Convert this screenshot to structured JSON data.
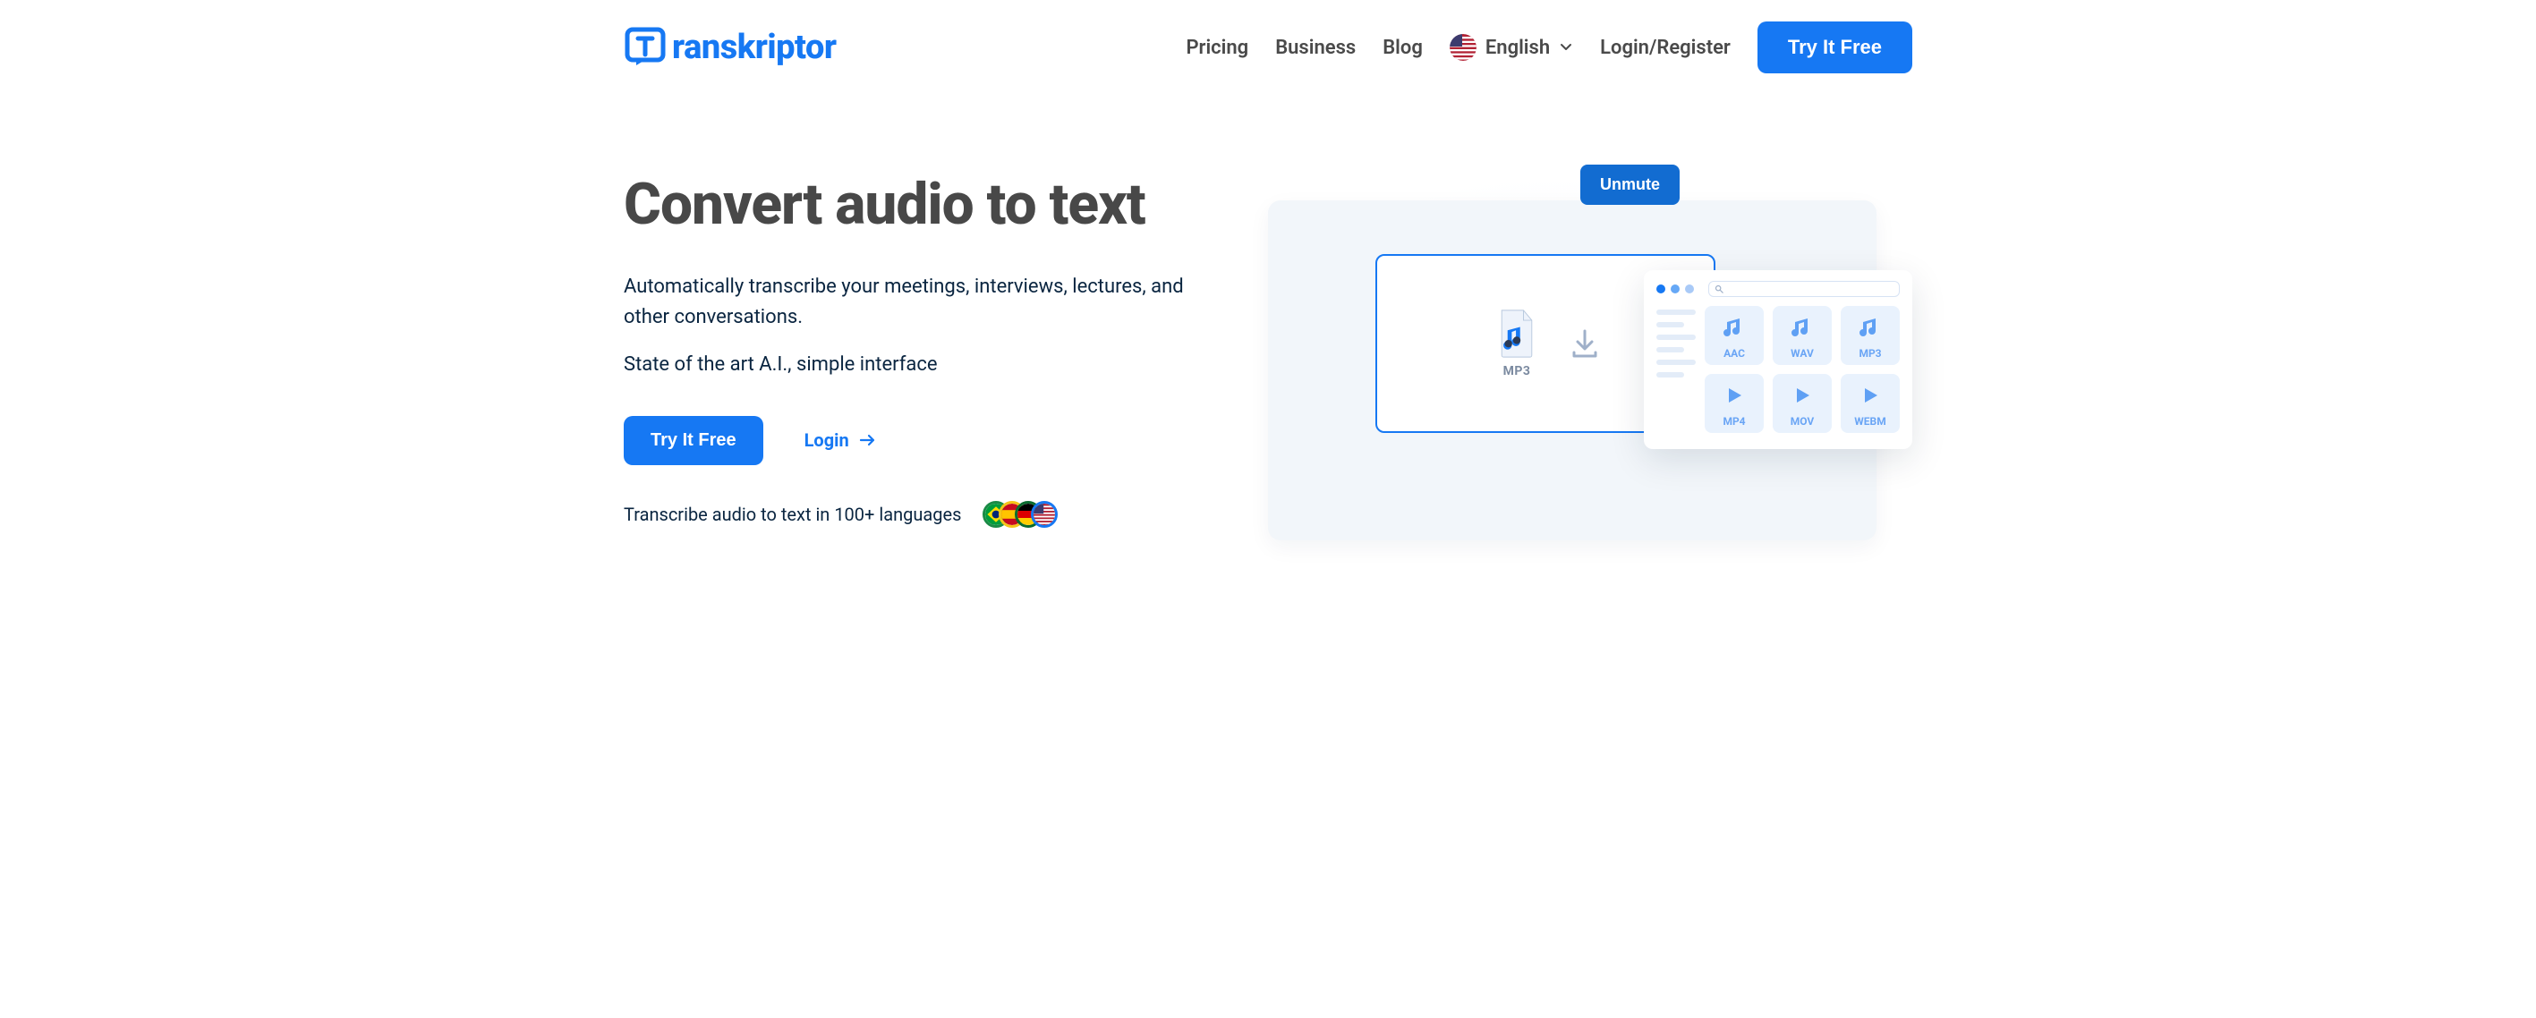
{
  "logo_text": "ranskriptor",
  "nav": {
    "pricing": "Pricing",
    "business": "Business",
    "blog": "Blog",
    "language_label": "English",
    "login_register": "Login/Register",
    "cta": "Try It Free"
  },
  "hero": {
    "title": "Convert audio to text",
    "sub1": "Automatically transcribe your meetings, interviews, lectures, and other conversations.",
    "sub2": "State of the art A.I., simple interface",
    "cta_primary": "Try It Free",
    "cta_login": "Login",
    "langs_text": "Transcribe audio to text in 100+ languages"
  },
  "illustration": {
    "unmute": "Unmute",
    "file_label": "MP3",
    "tiles": [
      {
        "label": "AAC",
        "kind": "audio"
      },
      {
        "label": "WAV",
        "kind": "audio"
      },
      {
        "label": "MP3",
        "kind": "audio"
      },
      {
        "label": "MP4",
        "kind": "video"
      },
      {
        "label": "MOV",
        "kind": "video"
      },
      {
        "label": "WEBM",
        "kind": "video"
      }
    ]
  }
}
